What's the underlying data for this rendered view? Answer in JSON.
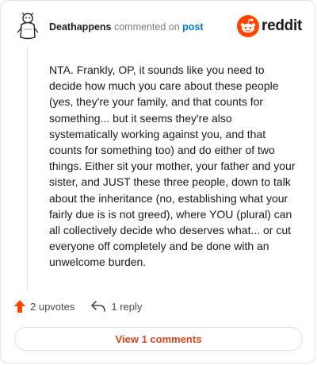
{
  "header": {
    "username": "Deathappens",
    "action": "commented on",
    "post_link": "post"
  },
  "brand": {
    "wordmark": "reddit",
    "logo_icon": "reddit-alien-icon",
    "accent_color": "#ff4500"
  },
  "comment": {
    "body": "NTA. Frankly, OP, it sounds like you need to decide how much you care about these people (yes, they're your family, and that counts for something... but it seems they're also systematically working against you, and that counts for something too) and do either of two things. Either sit your mother, your father and your sister, and JUST these three people, down to talk about the inheritance (no, establishing what your fairly due is is not greed), where YOU (plural) can all collectively decide who deserves what... or cut everyone off completely and be done with an unwelcome burden."
  },
  "actions": {
    "upvotes_label": "2 upvotes",
    "upvote_icon": "upvote-arrow-icon",
    "reply_label": "1 reply",
    "reply_icon": "reply-arrow-icon"
  },
  "view_comments_label": "View 1 comments"
}
